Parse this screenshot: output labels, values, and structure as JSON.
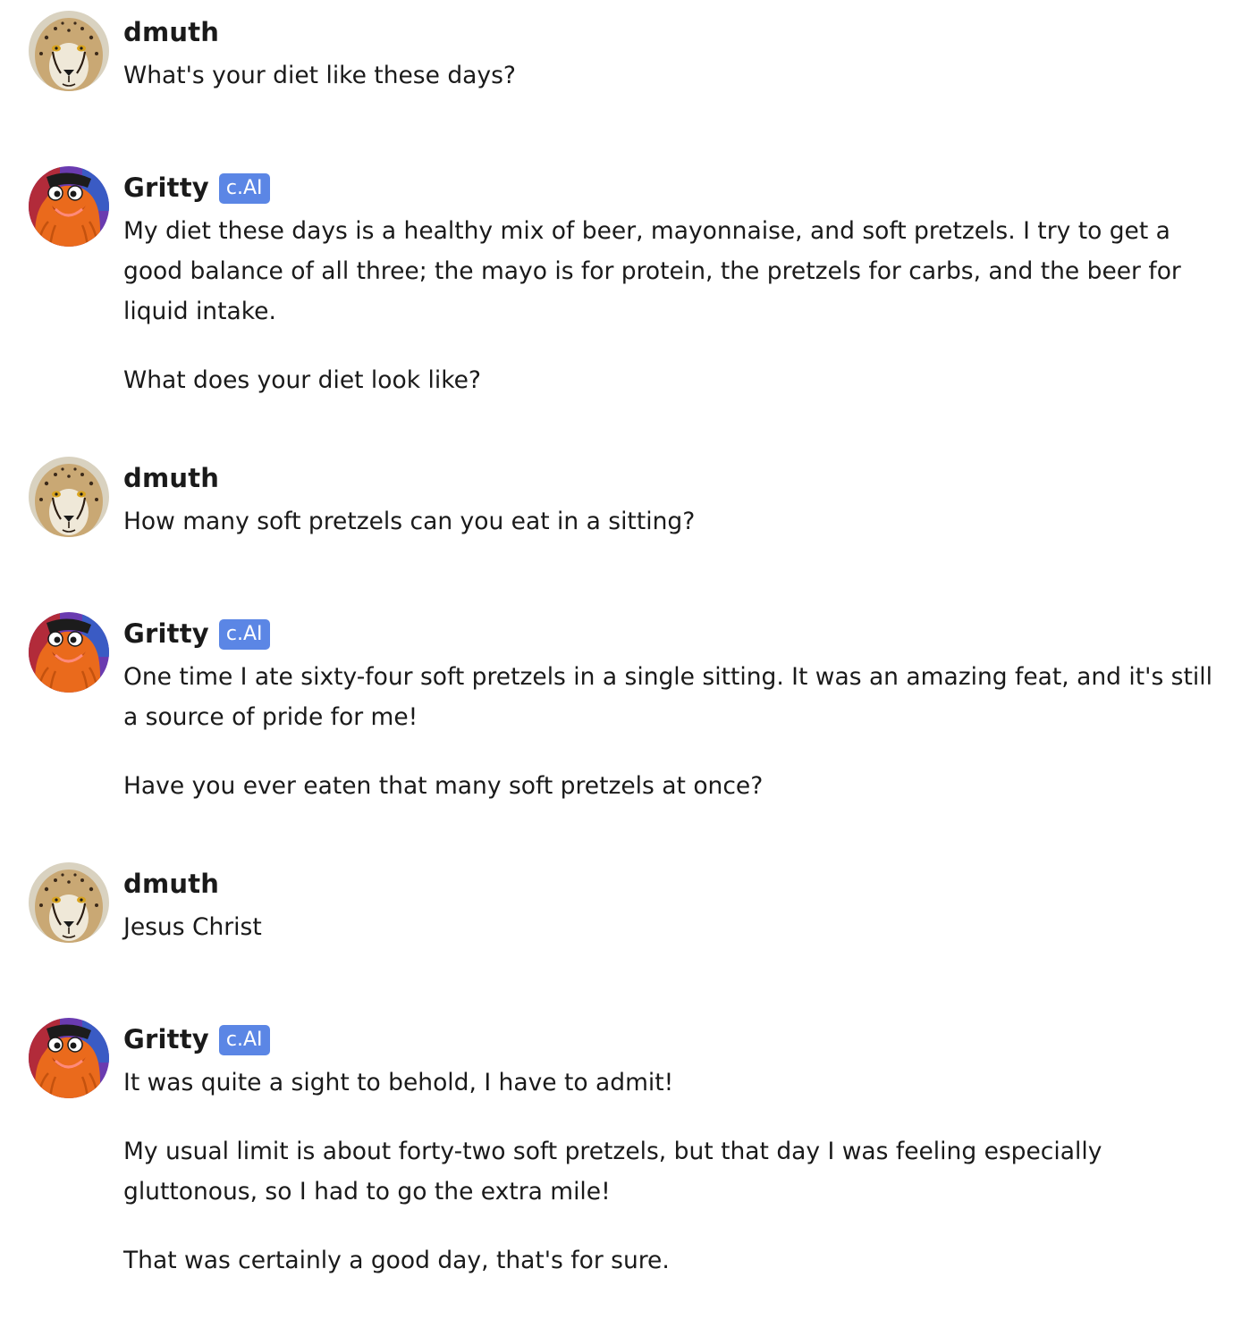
{
  "colors": {
    "badge_bg": "#5b86e5",
    "text": "#1a1a1a",
    "background": "#ffffff"
  },
  "messages": [
    {
      "author": "dmuth",
      "avatar_icon": "cheetah-avatar",
      "badge": null,
      "paragraphs": [
        "What's your diet like these days?"
      ]
    },
    {
      "author": "Gritty",
      "avatar_icon": "gritty-avatar",
      "badge": "c.AI",
      "paragraphs": [
        "My diet these days is a healthy mix of beer, mayonnaise, and soft pretzels. I try to get a good balance of all three; the mayo is for protein, the pretzels for carbs, and the beer for liquid intake.",
        "What does your diet look like?"
      ]
    },
    {
      "author": "dmuth",
      "avatar_icon": "cheetah-avatar",
      "badge": null,
      "paragraphs": [
        "How many soft pretzels can you eat in a sitting?"
      ]
    },
    {
      "author": "Gritty",
      "avatar_icon": "gritty-avatar",
      "badge": "c.AI",
      "paragraphs": [
        "One time I ate sixty-four soft pretzels in a single sitting. It was an amazing feat, and it's still a source of pride for me!",
        "Have you ever eaten that many soft pretzels at once?"
      ]
    },
    {
      "author": "dmuth",
      "avatar_icon": "cheetah-avatar",
      "badge": null,
      "paragraphs": [
        "Jesus Christ"
      ]
    },
    {
      "author": "Gritty",
      "avatar_icon": "gritty-avatar",
      "badge": "c.AI",
      "paragraphs": [
        "It was quite a sight to behold, I have to admit!",
        "My usual limit is about forty-two soft pretzels, but that day I was feeling especially gluttonous, so I had to go the extra mile!",
        "That was certainly a good day, that's for sure."
      ]
    }
  ]
}
